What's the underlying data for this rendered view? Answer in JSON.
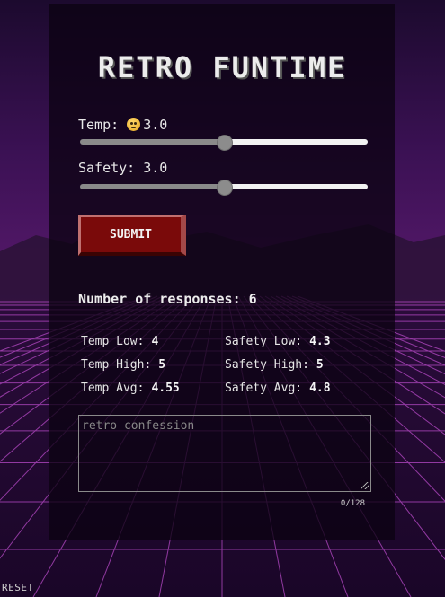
{
  "title": "RETRO FUNTIME",
  "temp": {
    "label": "Temp:",
    "value": "3.0",
    "slider_fraction": 0.5
  },
  "safety": {
    "label": "Safety:",
    "value": "3.0",
    "slider_fraction": 0.5
  },
  "submit_label": "SUBMIT",
  "responses": {
    "label": "Number of responses:",
    "count": "6"
  },
  "stats": {
    "temp_low": {
      "label": "Temp Low:",
      "value": "4"
    },
    "temp_high": {
      "label": "Temp High:",
      "value": "5"
    },
    "temp_avg": {
      "label": "Temp Avg:",
      "value": "4.55"
    },
    "safety_low": {
      "label": "Safety Low:",
      "value": "4.3"
    },
    "safety_high": {
      "label": "Safety High:",
      "value": "5"
    },
    "safety_avg": {
      "label": "Safety Avg:",
      "value": "4.8"
    }
  },
  "confession": {
    "placeholder": "retro confession",
    "counter": "0/128"
  },
  "reset_label": "RESET",
  "colors": {
    "accent": "#7a0a0a",
    "grid": "#c04ad0",
    "panel": "#0c0212"
  },
  "icons": {
    "temp_emoji": "face-with-rolling-eyes-icon"
  }
}
